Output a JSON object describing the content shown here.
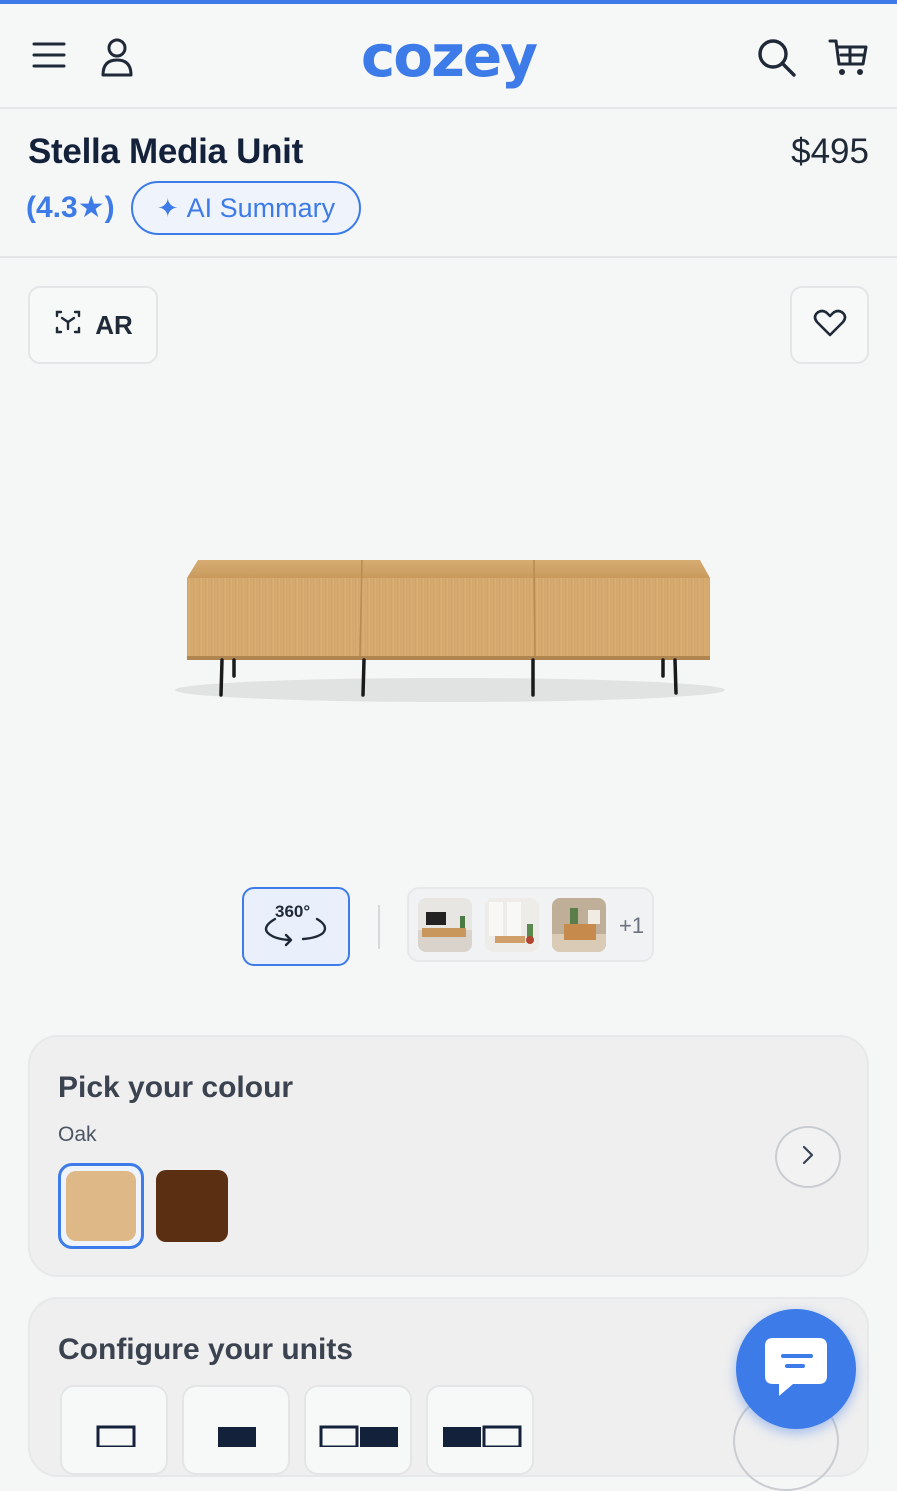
{
  "header": {
    "logo": "cozey",
    "icons": [
      "menu-icon",
      "account-icon",
      "search-icon",
      "cart-icon"
    ]
  },
  "product": {
    "title": "Stella Media Unit",
    "price": "$495",
    "rating": "(4.3★)",
    "ai_summary_label": "AI Summary"
  },
  "viewer": {
    "ar_label": "AR",
    "rotate_label": "360°",
    "more_images": "+1"
  },
  "colour": {
    "heading": "Pick your colour",
    "selected_name": "Oak",
    "swatches": [
      "#deb887",
      "#5a2f12"
    ]
  },
  "config": {
    "heading": "Configure your units"
  },
  "colors": {
    "accent": "#3d7be8",
    "title": "#14213a"
  }
}
